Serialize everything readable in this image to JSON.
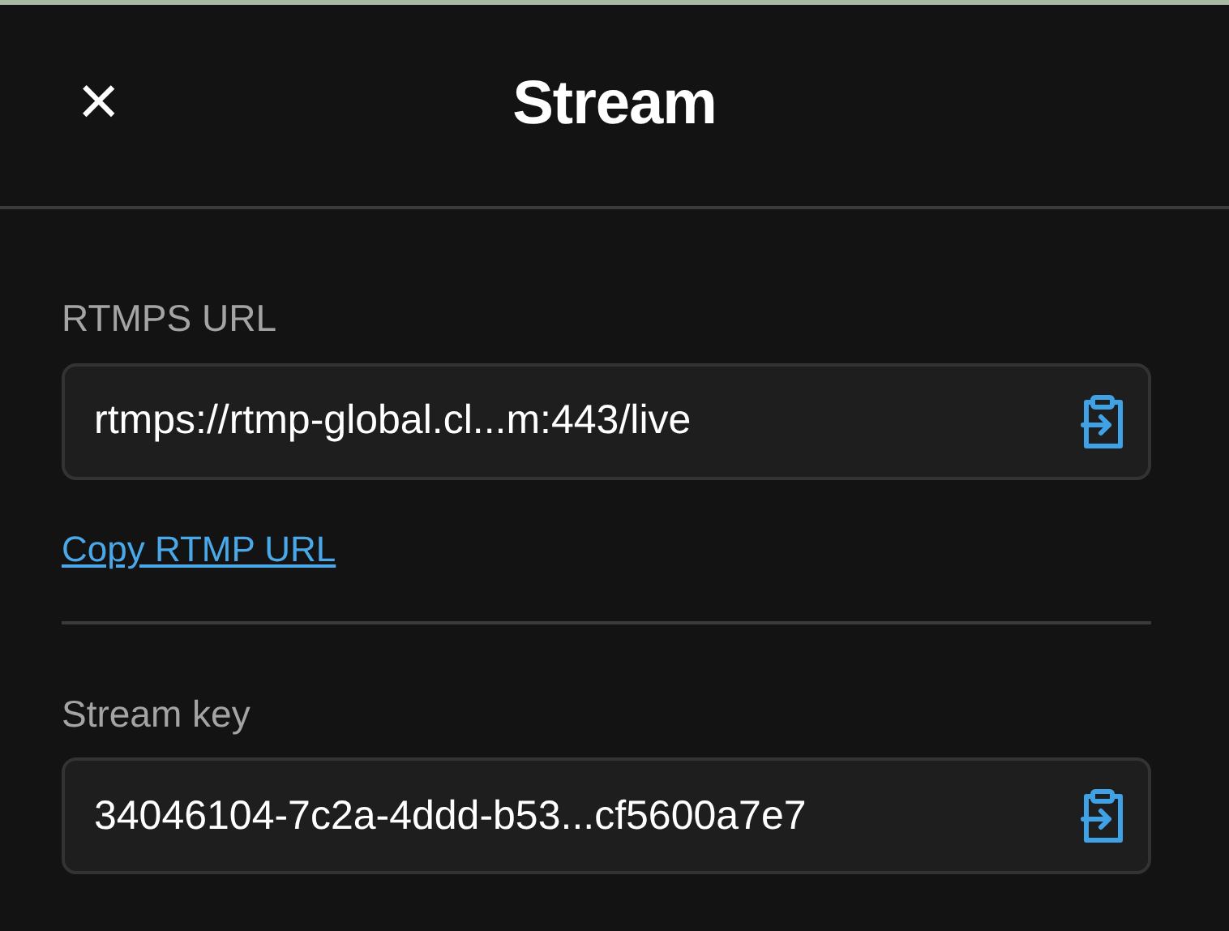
{
  "header": {
    "close": "×",
    "title": "Stream"
  },
  "fields": [
    {
      "label": "RTMPS URL",
      "value": "rtmps://rtmp-global.cl...m:443/live",
      "link": "Copy RTMP URL"
    },
    {
      "label": "Stream key",
      "value": "34046104-7c2a-4ddd-b53...cf5600a7e7"
    }
  ]
}
